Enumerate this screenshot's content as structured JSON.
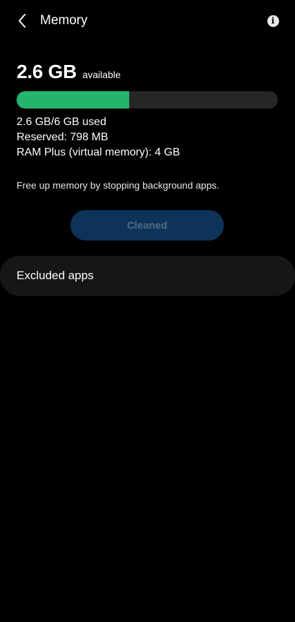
{
  "header": {
    "title": "Memory",
    "back_icon": "chevron-left-icon",
    "info_icon": "info-icon",
    "info_glyph": "i"
  },
  "memory": {
    "available_value": "2.6 GB",
    "available_label": "available",
    "used_fraction": 0.43,
    "used_text": "2.6 GB/6 GB used",
    "reserved_text": "Reserved: 798 MB",
    "ram_plus_text": "RAM Plus (virtual memory): 4 GB",
    "bar_color": "#25b46d",
    "bar_track_color": "#262626"
  },
  "hint": "Free up memory by stopping background apps.",
  "clean_button": {
    "label": "Cleaned",
    "state": "disabled"
  },
  "excluded_apps": {
    "label": "Excluded apps"
  }
}
